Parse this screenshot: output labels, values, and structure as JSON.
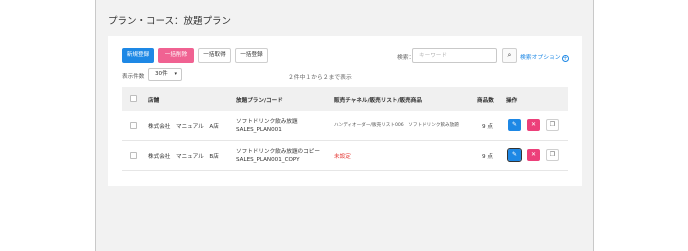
{
  "page": {
    "title": "プラン・コース：放題プラン"
  },
  "toolbar": {
    "new_label": "新規登録",
    "bulk_delete_label": "一括削除",
    "bulk_get_label": "一括取得",
    "bulk_register_label": "一括登録"
  },
  "search": {
    "label": "検索：",
    "placeholder": "キーワード",
    "options_label": "検索オプション"
  },
  "list": {
    "per_page_label": "表示件数",
    "per_page_value": "30件",
    "result_text": "２件中１から２まで表示"
  },
  "table": {
    "headers": [
      "店舗",
      "放題プラン/コード",
      "販売チャネル/販売リスト/販売商品",
      "商品数",
      "操作"
    ],
    "rows": [
      {
        "store": "株式会社　マニュアル　A店",
        "plan_name": "ソフトドリンク飲み放題",
        "plan_code": "SALES_PLAN001",
        "channel": "ハンディオーダー/販売リスト006　ソフトドリンク飲み放題",
        "count": "9 点"
      },
      {
        "store": "株式会社　マニュアル　B店",
        "plan_name": "ソフトドリンク飲み放題のコピー",
        "plan_code": "SALES_PLAN001_COPY",
        "channel": "未設定",
        "count": "9 点"
      }
    ]
  },
  "colors": {
    "primary": "#1e88e5",
    "danger": "#ec407a",
    "unset": "#e53935"
  }
}
